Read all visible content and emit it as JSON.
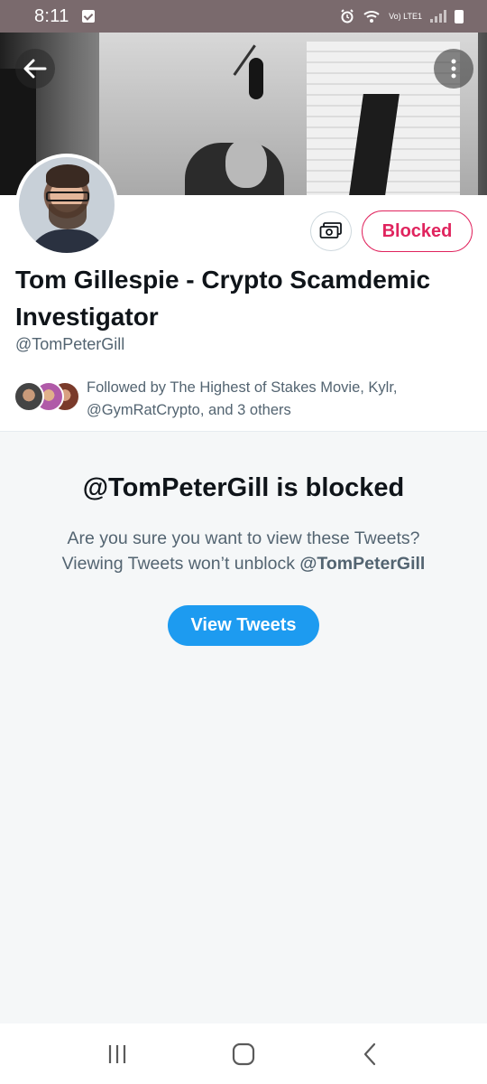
{
  "status_bar": {
    "time": "8:11",
    "network_label": "Vo) LTE1"
  },
  "profile": {
    "display_name": "Tom Gillespie - Crypto Scamdemic Investigator",
    "handle": "@TomPeterGill",
    "blocked_button_label": "Blocked",
    "followed_by": "Followed by The Highest of Stakes Movie, Kylr, @GymRatCrypto, and 3 others"
  },
  "blocked_notice": {
    "title": "@TomPeterGill is blocked",
    "message_line1": "Are you sure you want to view these Tweets?",
    "message_line2_prefix": "Viewing Tweets won’t unblock ",
    "message_line2_handle": "@TomPeterGill",
    "view_button_label": "View Tweets"
  },
  "icons": {
    "back": "arrow-left-icon",
    "more": "more-vertical-icon",
    "tip": "money-icon",
    "nav_recents": "recents-icon",
    "nav_home": "home-icon",
    "nav_back": "chevron-left-icon"
  },
  "colors": {
    "accent": "#1d9bf0",
    "blocked": "#e0245e",
    "status_bar": "#7a6a6d",
    "secondary_text": "#536471"
  }
}
